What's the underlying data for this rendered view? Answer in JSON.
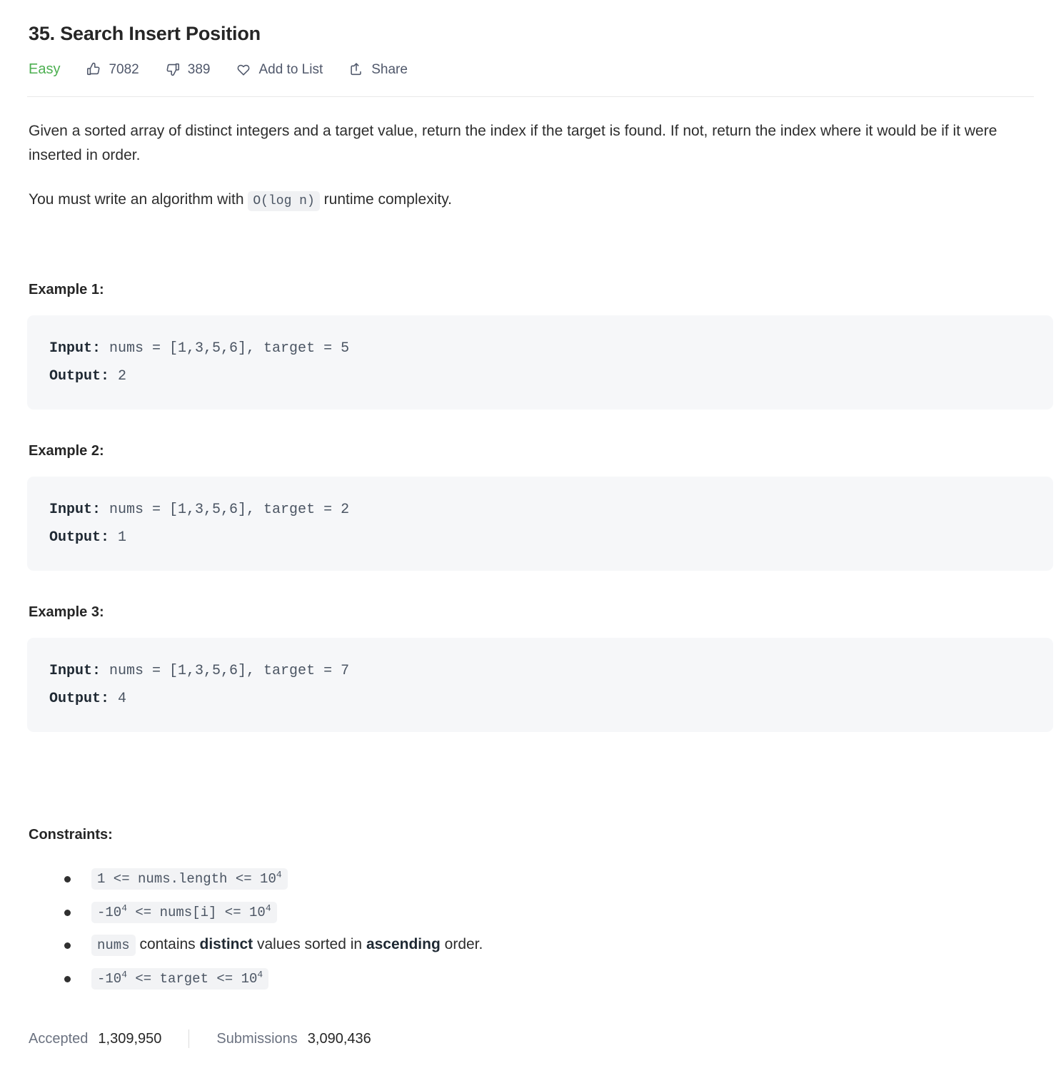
{
  "problem": {
    "title": "35. Search Insert Position",
    "difficulty": "Easy",
    "difficulty_color": "#4caf50"
  },
  "meta": {
    "likes_icon": "thumbs-up-icon",
    "likes": "7082",
    "dislikes_icon": "thumbs-down-icon",
    "dislikes": "389",
    "add_to_list_icon": "heart-icon",
    "add_to_list": "Add to List",
    "share_icon": "share-icon",
    "share": "Share"
  },
  "description": {
    "paragraph1": "Given a sorted array of distinct integers and a target value, return the index if the target is found. If not, return the index where it would be if it were inserted in order.",
    "paragraph2_before": "You must write an algorithm with",
    "paragraph2_code": "O(log n)",
    "paragraph2_after": "runtime complexity."
  },
  "examples": [
    {
      "heading": "Example 1:",
      "input_label": "Input:",
      "input_value": " nums = [1,3,5,6], target = 5",
      "output_label": "Output:",
      "output_value": " 2"
    },
    {
      "heading": "Example 2:",
      "input_label": "Input:",
      "input_value": " nums = [1,3,5,6], target = 2",
      "output_label": "Output:",
      "output_value": " 1"
    },
    {
      "heading": "Example 3:",
      "input_label": "Input:",
      "input_value": " nums = [1,3,5,6], target = 7",
      "output_label": "Output:",
      "output_value": " 4"
    }
  ],
  "constraints": {
    "heading": "Constraints:",
    "items": [
      {
        "code_prefix": "1 <= nums.length <= 10",
        "code_sup": "4"
      },
      {
        "code_prefix": "-10",
        "code_sup": "4",
        "code_mid": " <= nums[i] <= 10",
        "code_sup2": "4"
      },
      {
        "code_text": "nums",
        "text_a": " contains ",
        "bold_a": "distinct",
        "text_b": " values sorted in ",
        "bold_b": "ascending",
        "text_c": " order."
      },
      {
        "code_prefix": "-10",
        "code_sup": "4",
        "code_mid": " <= target <= 10",
        "code_sup2": "4"
      }
    ]
  },
  "stats": {
    "accepted_label": "Accepted",
    "accepted_value": "1,309,950",
    "submissions_label": "Submissions",
    "submissions_value": "3,090,436"
  }
}
